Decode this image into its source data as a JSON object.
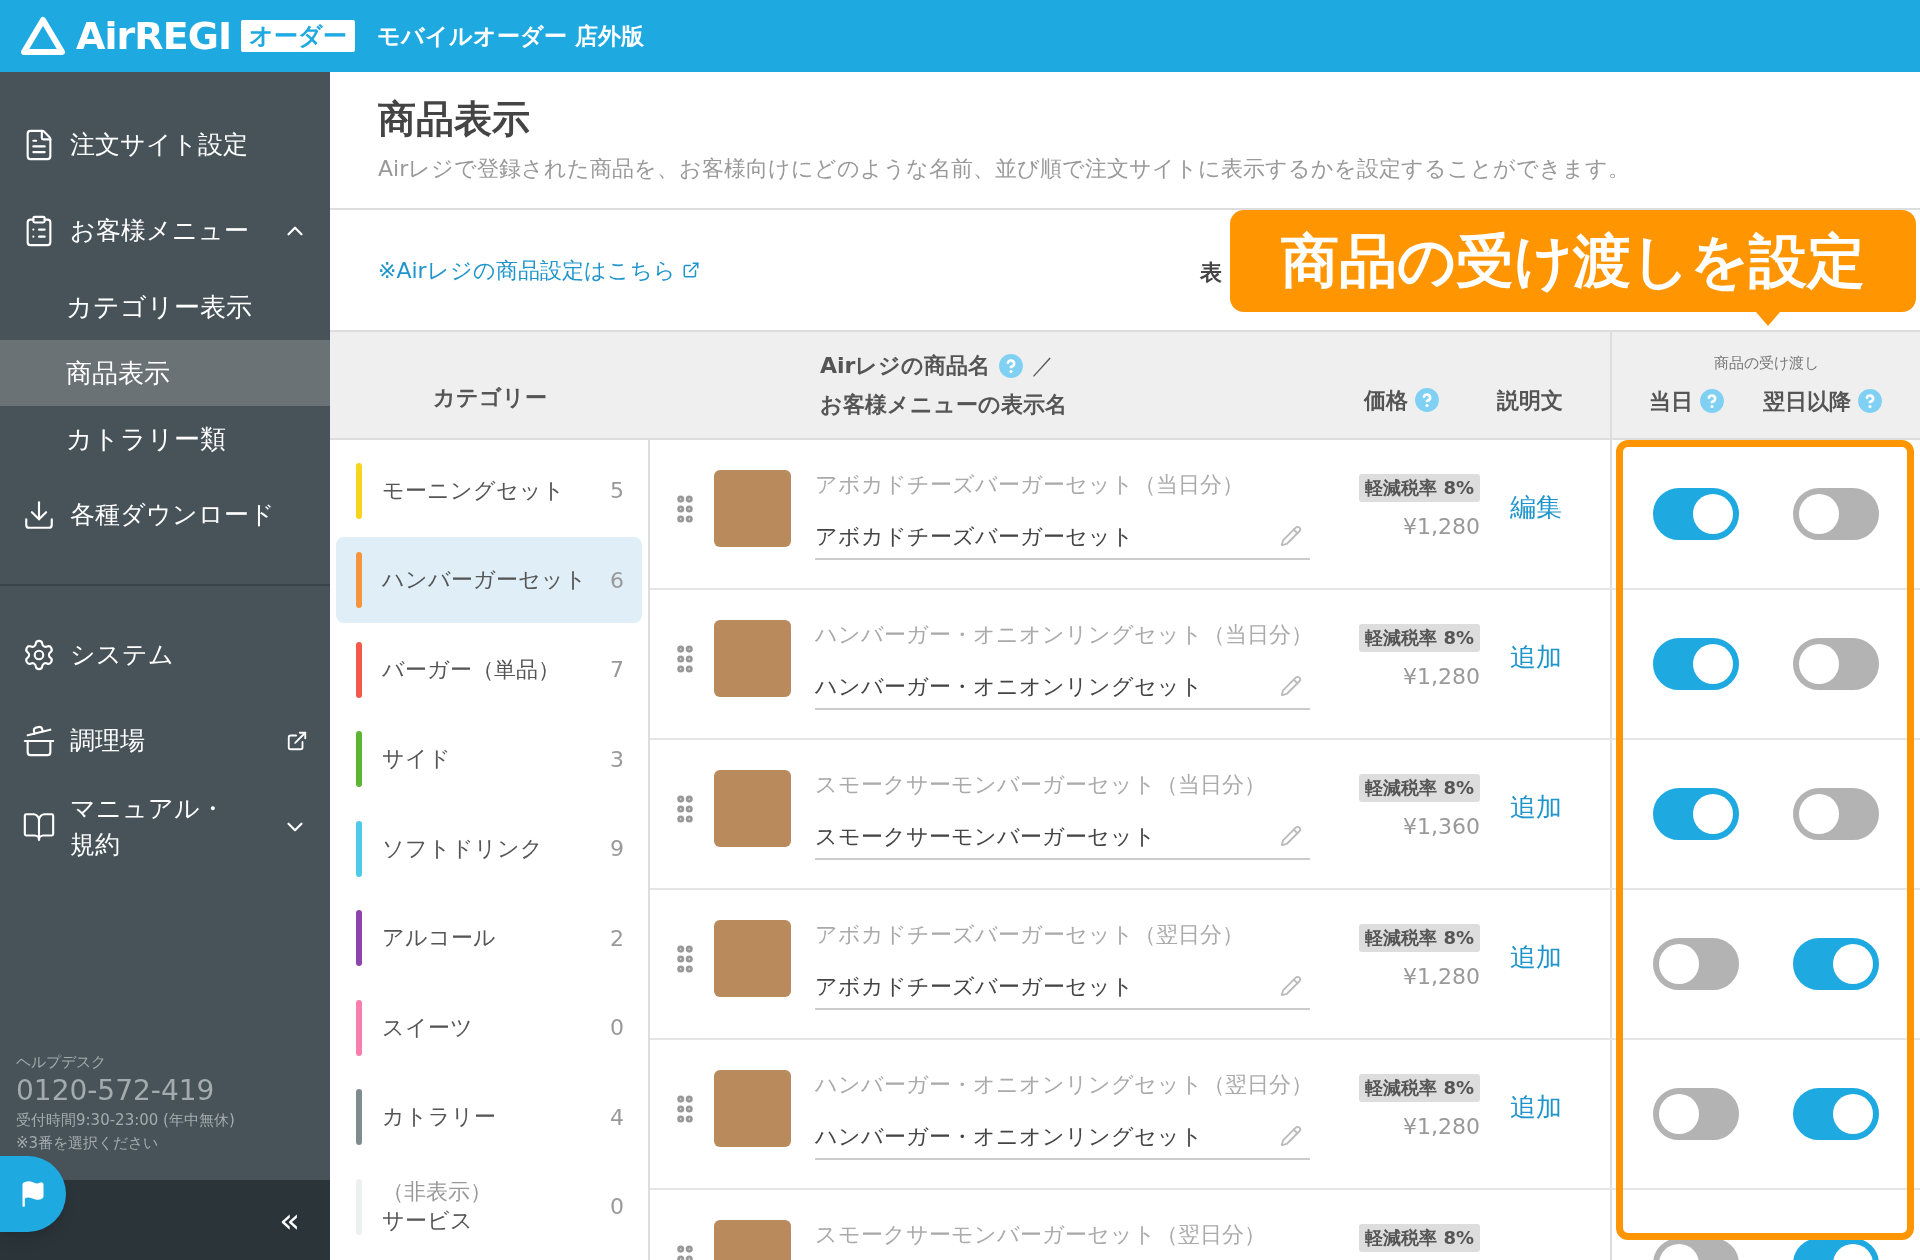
{
  "header": {
    "logo": "AirREGI",
    "badge": "オーダー",
    "subtitle": "モバイルオーダー 店外版"
  },
  "sidebar": {
    "groups": [
      [
        {
          "label": "注文サイト設定"
        },
        {
          "label": "お客様メニュー",
          "expanded": true,
          "children": [
            {
              "label": "カテゴリー表示",
              "selected": false
            },
            {
              "label": "商品表示",
              "selected": true
            },
            {
              "label": "カトラリー類",
              "selected": false
            }
          ]
        },
        {
          "label": "各種ダウンロード"
        }
      ],
      [
        {
          "label": "システム"
        },
        {
          "label": "調理場",
          "external": true
        },
        {
          "label": "マニュアル・規約",
          "expanded": false
        }
      ]
    ],
    "helpdesk": {
      "label": "ヘルプデスク",
      "phone": "0120-572-419",
      "hours": "受付時間9:30-23:00 (年中無休)",
      "note": "※3番を選択ください"
    },
    "collapse": "«"
  },
  "page": {
    "title": "商品表示",
    "description": "Airレジで登録された商品を、お客様向けにどのような名前、並び順で注文サイトに表示するかを設定することができます。",
    "link": "※Airレジの商品設定はこちら",
    "partial_label": "表",
    "callout": "商品の受け渡しを設定"
  },
  "table": {
    "columns": {
      "category": "カテゴリー",
      "name_top": "Airレジの商品名",
      "name_sep": "／",
      "name_bottom": "お客様メニューの表示名",
      "price": "価格",
      "description": "説明文",
      "handover": "商品の受け渡し",
      "same_day": "当日",
      "next_day": "翌日以降"
    },
    "categories": [
      {
        "name": "モーニングセット",
        "count": "5",
        "color": "#f7d51d",
        "selected": false
      },
      {
        "name": "ハンバーガーセット",
        "count": "6",
        "color": "#f7943e",
        "selected": true
      },
      {
        "name": "バーガー（単品）",
        "count": "7",
        "color": "#f2594b",
        "selected": false
      },
      {
        "name": "サイド",
        "count": "3",
        "color": "#5cb531",
        "selected": false
      },
      {
        "name": "ソフトドリンク",
        "count": "9",
        "color": "#4fc9e8",
        "selected": false
      },
      {
        "name": "アルコール",
        "count": "2",
        "color": "#8e44ad",
        "selected": false
      },
      {
        "name": "スイーツ",
        "count": "0",
        "color": "#f77fad",
        "selected": false
      },
      {
        "name": "カトラリー",
        "count": "4",
        "color": "#7f8c8d",
        "selected": false
      },
      {
        "name": "サービス",
        "count": "0",
        "color": "#ecf0f1",
        "selected": false,
        "hidden_tag": "（非表示）"
      }
    ],
    "products": [
      {
        "original": "アボカドチーズバーガーセット（当日分）",
        "display": "アボカドチーズバーガーセット",
        "tax": "軽減税率 8%",
        "price": "¥1,280",
        "action": "編集",
        "same_day": true,
        "next_day": false
      },
      {
        "original": "ハンバーガー・オニオンリングセット（当日分）",
        "display": "ハンバーガー・オニオンリングセット",
        "tax": "軽減税率 8%",
        "price": "¥1,280",
        "action": "追加",
        "same_day": true,
        "next_day": false
      },
      {
        "original": "スモークサーモンバーガーセット（当日分）",
        "display": "スモークサーモンバーガーセット",
        "tax": "軽減税率 8%",
        "price": "¥1,360",
        "action": "追加",
        "same_day": true,
        "next_day": false
      },
      {
        "original": "アボカドチーズバーガーセット（翌日分）",
        "display": "アボカドチーズバーガーセット",
        "tax": "軽減税率 8%",
        "price": "¥1,280",
        "action": "追加",
        "same_day": false,
        "next_day": true
      },
      {
        "original": "ハンバーガー・オニオンリングセット（翌日分）",
        "display": "ハンバーガー・オニオンリングセット",
        "tax": "軽減税率 8%",
        "price": "¥1,280",
        "action": "追加",
        "same_day": false,
        "next_day": true
      },
      {
        "original": "スモークサーモンバーガーセット（翌日分）",
        "tax": "軽減税率 8%",
        "same_day": false,
        "next_day": true
      }
    ]
  }
}
